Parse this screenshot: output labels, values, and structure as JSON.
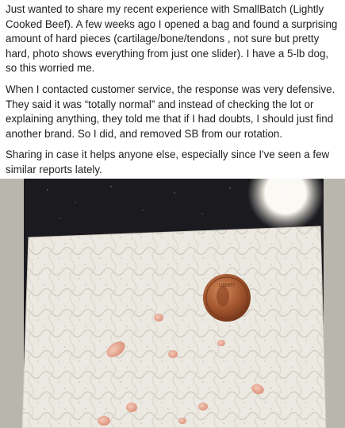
{
  "post": {
    "paragraphs": [
      "Just wanted to share my recent experience with SmallBatch (Lightly Cooked Beef). A few weeks ago I opened a bag and found a surprising amount of hard pieces (cartilage/bone/tendons , not sure but pretty hard, photo shows everything from just one slider). I have a 5-lb dog, so this worried me.",
      "When I contacted customer service, the response was very defensive. They said it was “totally normal” and instead of checking the lot or explaining anything, they told me that if I had doubts, I should just find another brand. So I did, and removed SB from our rotation.",
      "Sharing in case it helps anyone else, especially since I've seen a few similar reports lately."
    ]
  },
  "photo": {
    "subject": "hard pieces on paper towel next to a coin",
    "coin_text": "LIBERTY",
    "colors": {
      "background_surface": "#1b1a1f",
      "paper_towel": "#ece9e2",
      "coin": "#a0532c",
      "pieces": "#e3a08c",
      "side_border": "#b9b7ad"
    }
  }
}
